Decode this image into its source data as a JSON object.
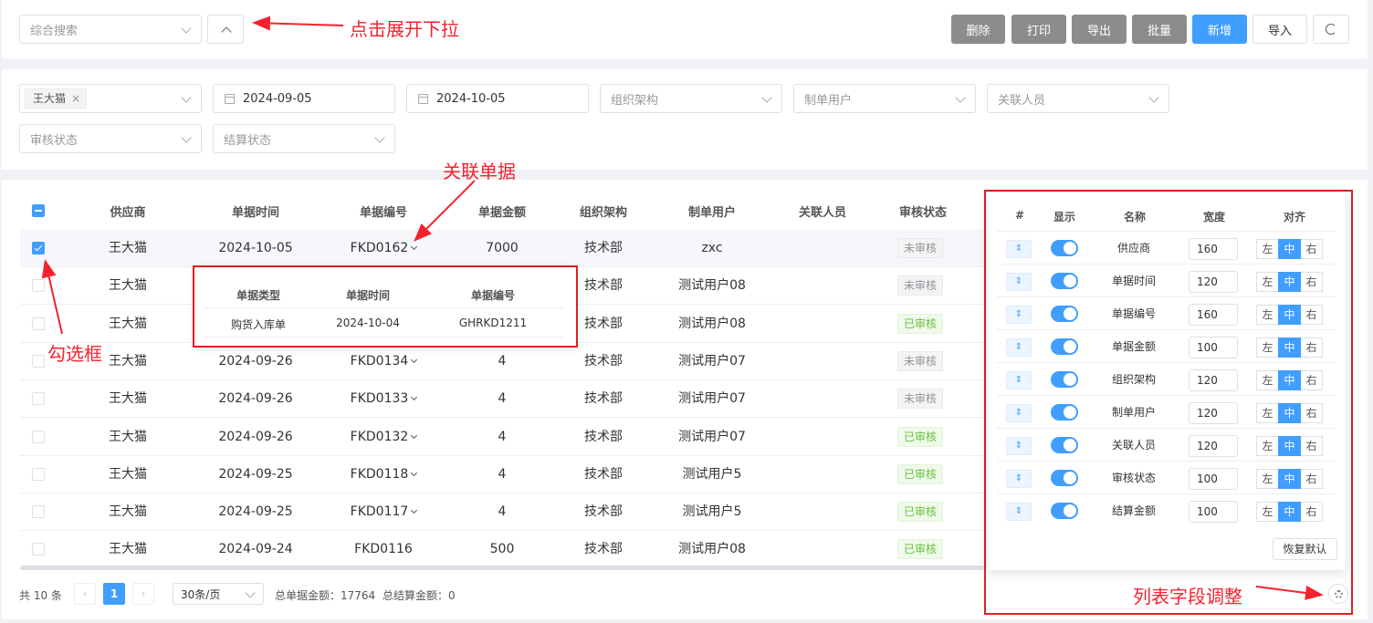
{
  "top": {
    "search_placeholder": "综合搜索",
    "buttons": {
      "delete": "删除",
      "print": "打印",
      "export": "导出",
      "batch": "批量",
      "add": "新增",
      "import": "导入"
    }
  },
  "filters": {
    "supplier_tag": "王大猫",
    "start_date": "2024-09-05",
    "end_date": "2024-10-05",
    "org": "组织架构",
    "creator": "制单用户",
    "related": "关联人员",
    "audit": "审核状态",
    "settle": "结算状态"
  },
  "annotations": {
    "expand": "点击展开下拉",
    "linked": "关联单据",
    "checkbox": "勾选框",
    "columns": "列表字段调整"
  },
  "table": {
    "headers": [
      "供应商",
      "单据时间",
      "单据编号",
      "单据金额",
      "组织架构",
      "制单用户",
      "关联人员",
      "审核状态"
    ],
    "rows": [
      {
        "supplier": "王大猫",
        "date": "2024-10-05",
        "no": "FKD0162",
        "amount": "7000",
        "org": "技术部",
        "user": "zxc",
        "status": "未审核"
      },
      {
        "supplier": "王大猫",
        "date": "",
        "no": "",
        "amount": "",
        "org": "技术部",
        "user": "测试用户08",
        "status": "未审核"
      },
      {
        "supplier": "王大猫",
        "date": "",
        "no": "",
        "amount": "",
        "org": "技术部",
        "user": "测试用户08",
        "status": "已审核"
      },
      {
        "supplier": "王大猫",
        "date": "2024-09-26",
        "no": "FKD0134",
        "amount": "4",
        "org": "技术部",
        "user": "测试用户07",
        "status": "未审核"
      },
      {
        "supplier": "王大猫",
        "date": "2024-09-26",
        "no": "FKD0133",
        "amount": "4",
        "org": "技术部",
        "user": "测试用户07",
        "status": "未审核"
      },
      {
        "supplier": "王大猫",
        "date": "2024-09-26",
        "no": "FKD0132",
        "amount": "4",
        "org": "技术部",
        "user": "测试用户07",
        "status": "已审核"
      },
      {
        "supplier": "王大猫",
        "date": "2024-09-25",
        "no": "FKD0118",
        "amount": "4",
        "org": "技术部",
        "user": "测试用户5",
        "status": "已审核"
      },
      {
        "supplier": "王大猫",
        "date": "2024-09-25",
        "no": "FKD0117",
        "amount": "4",
        "org": "技术部",
        "user": "测试用户5",
        "status": "已审核"
      },
      {
        "supplier": "王大猫",
        "date": "2024-09-24",
        "no": "FKD0116",
        "amount": "500",
        "org": "技术部",
        "user": "测试用户08",
        "status": "已审核"
      }
    ]
  },
  "popover": {
    "headers": [
      "单据类型",
      "单据时间",
      "单据编号"
    ],
    "row": [
      "购货入库单",
      "2024-10-04",
      "GHRKD1211"
    ]
  },
  "pager": {
    "total": "共 10 条",
    "page": "1",
    "size": "30条/页",
    "sum_amount": "总单据金额：17764",
    "sum_settle": "总结算金额：0"
  },
  "settings": {
    "headers": [
      "#",
      "显示",
      "名称",
      "宽度",
      "对齐"
    ],
    "rows": [
      {
        "name": "供应商",
        "width": "160"
      },
      {
        "name": "单据时间",
        "width": "120"
      },
      {
        "name": "单据编号",
        "width": "160"
      },
      {
        "name": "单据金额",
        "width": "100"
      },
      {
        "name": "组织架构",
        "width": "120"
      },
      {
        "name": "制单用户",
        "width": "120"
      },
      {
        "name": "关联人员",
        "width": "120"
      },
      {
        "name": "审核状态",
        "width": "100"
      },
      {
        "name": "结算金额",
        "width": "100"
      }
    ],
    "align": [
      "左",
      "中",
      "右"
    ],
    "reset": "恢复默认"
  }
}
